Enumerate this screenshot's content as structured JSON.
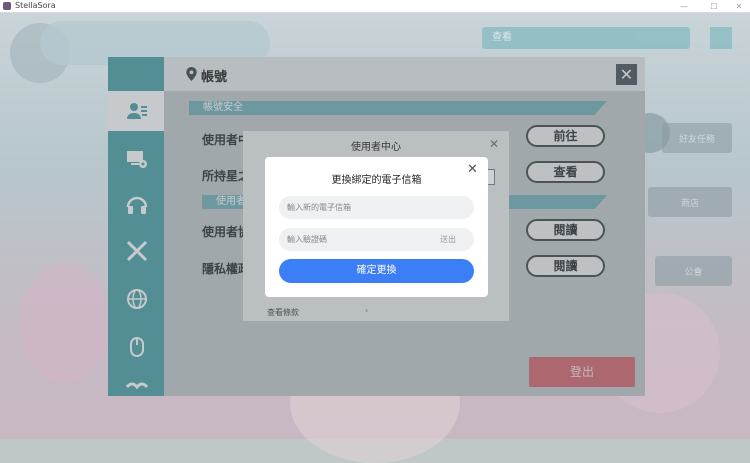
{
  "window": {
    "title": "StellaSora"
  },
  "background": {
    "search_label": "查看",
    "side_btn_1": "好友任務",
    "side_btn_2": "商店",
    "side_btn_3": "公會"
  },
  "sidebar": {
    "items": [
      {
        "icon": "account-icon",
        "active": true
      },
      {
        "icon": "display-settings-icon",
        "active": false
      },
      {
        "icon": "headphones-icon",
        "active": false
      },
      {
        "icon": "battle-icon",
        "active": false
      },
      {
        "icon": "globe-icon",
        "active": false
      },
      {
        "icon": "mouse-icon",
        "active": false
      },
      {
        "icon": "more-icon",
        "active": false
      }
    ]
  },
  "panel": {
    "title": "帳號",
    "section_account": "帳號安全",
    "section_user": "使用者",
    "row1_label": "使用者中",
    "row2_label": "所持星之",
    "row3_label": "使用者協",
    "row4_label": "隱私權政",
    "btn_goto": "前往",
    "btn_view": "查看",
    "btn_read1": "閱讀",
    "btn_read2": "閱讀",
    "logout": "登出"
  },
  "user_center": {
    "title": "使用者中心",
    "view_terms": "查看條款"
  },
  "email_dialog": {
    "title": "更換綁定的電子信箱",
    "email_placeholder": "輸入新的電子信箱",
    "code_placeholder": "輸入驗證碼",
    "send_code": "送出",
    "confirm": "確定更換"
  }
}
